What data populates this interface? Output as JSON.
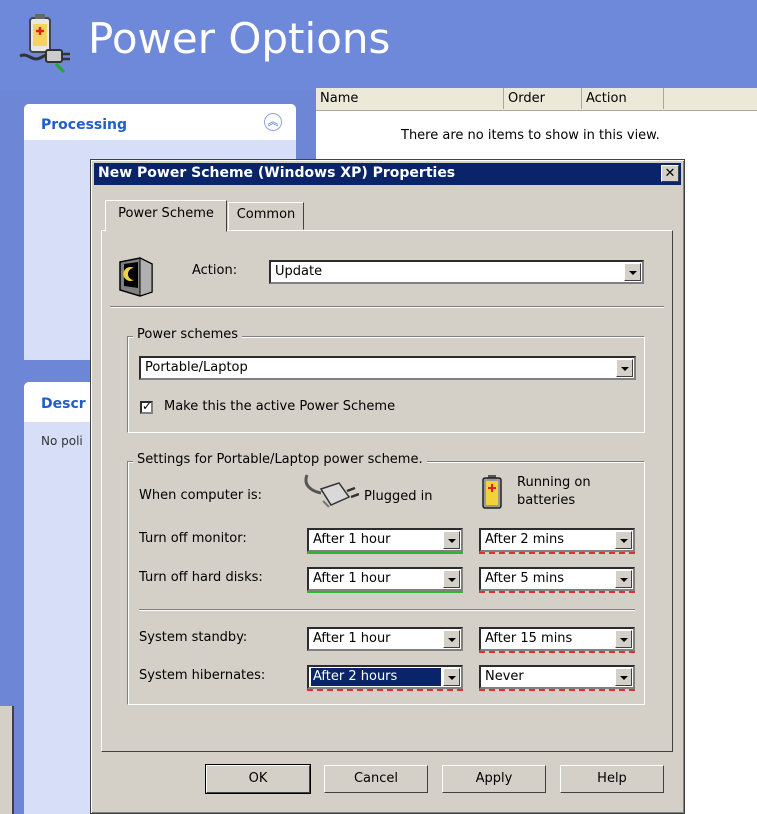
{
  "console": {
    "title": "Power Options",
    "list_columns": [
      "Name",
      "Order",
      "Action"
    ],
    "empty_message": "There are no items to show in this view.",
    "processing_title": "Processing",
    "description_title": "Descr",
    "description_body": "No poli"
  },
  "dialog": {
    "title": "New Power Scheme (Windows XP) Properties",
    "close_glyph": "✕",
    "tabs": [
      {
        "label": "Power Scheme",
        "active": true
      },
      {
        "label": "Common",
        "active": false
      }
    ],
    "action": {
      "label": "Action:",
      "value": "Update"
    },
    "power_schemes": {
      "group_label": "Power schemes",
      "value": "Portable/Laptop",
      "active_checkbox_label": "Make this the active Power Scheme",
      "active_checked": true
    },
    "settings": {
      "group_label": "Settings for Portable/Laptop power scheme.",
      "when_label": "When computer is:",
      "plugged_label": "Plugged in",
      "battery_label_line1": "Running on",
      "battery_label_line2": "batteries",
      "rows": [
        {
          "label": "Turn off monitor:",
          "plugged": "After 1 hour",
          "battery": "After 2 mins"
        },
        {
          "label": "Turn off hard disks:",
          "plugged": "After 1 hour",
          "battery": "After 5 mins"
        },
        {
          "label": "System standby:",
          "plugged": "After 1 hour",
          "battery": "After 15 mins"
        },
        {
          "label": "System hibernates:",
          "plugged": "After 2 hours",
          "battery": "Never"
        }
      ]
    },
    "buttons": {
      "ok": "OK",
      "cancel": "Cancel",
      "apply": "Apply",
      "help": "Help"
    }
  },
  "colors": {
    "console_bg": "#6f89da",
    "title_bar": "#0a246a",
    "dialog_face": "#d4d0c8",
    "plugged_underline": "#2fb52f",
    "battery_underline": "#e03030"
  },
  "icons": [
    "power-options-icon",
    "collapse-chevrons-icon",
    "monitor-moon-icon",
    "plug-icon",
    "battery-icon",
    "dropdown-arrow-icon",
    "close-icon",
    "checkmark-icon"
  ]
}
